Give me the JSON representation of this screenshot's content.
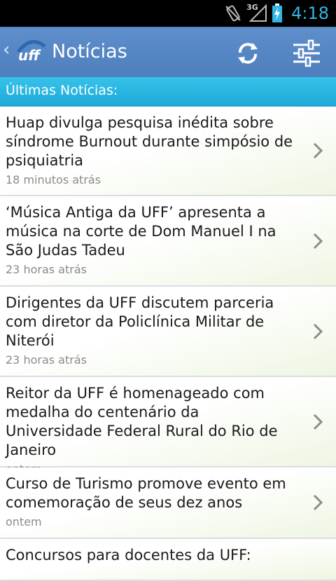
{
  "status_bar": {
    "network": "3G",
    "time": "4:18"
  },
  "app": {
    "logo_text": "uff",
    "title": "Notícias"
  },
  "section": {
    "header": "Últimas Notícias:"
  },
  "news": [
    {
      "headline": "Huap divulga pesquisa inédita sobre síndrome Burnout durante simpósio de psiquiatria",
      "time": "18 minutos atrás"
    },
    {
      "headline": "‘Música Antiga da UFF’ apresenta a música na corte de Dom Manuel I na São Judas Tadeu",
      "time": "23 horas atrás"
    },
    {
      "headline": "Dirigentes da UFF discutem parceria com diretor da Policlínica Militar de Niterói",
      "time": "23 horas atrás"
    },
    {
      "headline": "Reitor da UFF é homenageado com medalha do centenário da Universidade Federal Rural do Rio de Janeiro",
      "time": "ontem"
    },
    {
      "headline": "Curso de Turismo promove evento em comemoração de seus dez anos",
      "time": "ontem"
    },
    {
      "headline": "Concursos para docentes da UFF:",
      "time": ""
    }
  ],
  "colors": {
    "action_bar": "#5785c4",
    "section": "#2bb5e1",
    "status_time": "#33b5e5"
  }
}
